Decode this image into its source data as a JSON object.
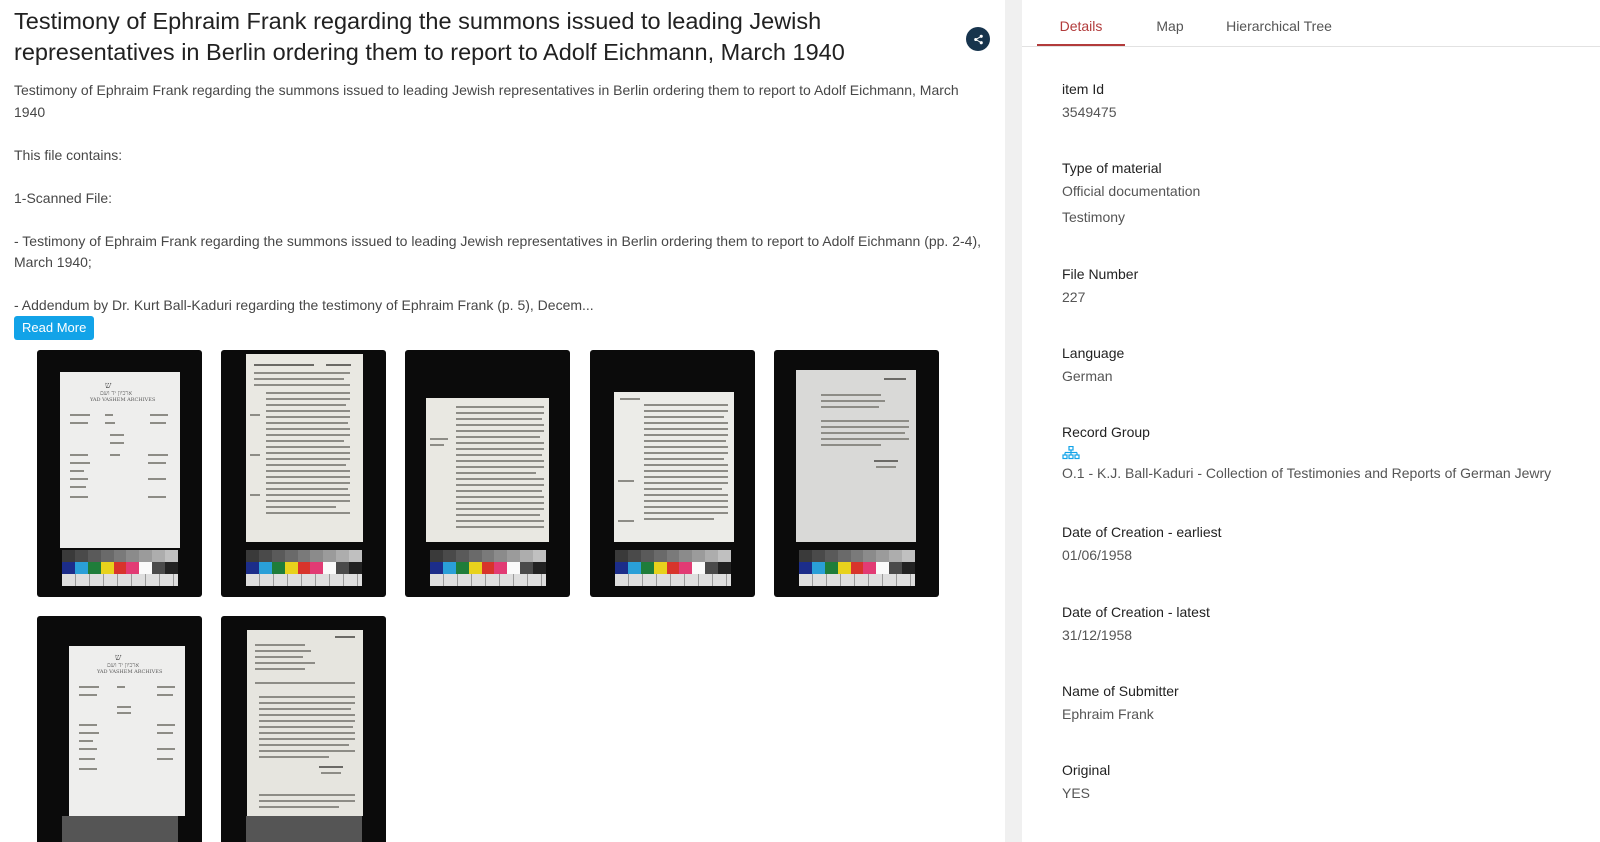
{
  "header": {
    "title": "Testimony of Ephraim Frank regarding the summons issued to leading Jewish representatives in Berlin ordering them to report to Adolf Eichmann, March 1940",
    "share_icon": "share-icon"
  },
  "description": {
    "lines": [
      "Testimony of Ephraim Frank regarding the summons issued to leading Jewish representatives in Berlin ordering them to report to Adolf Eichmann, March 1940",
      "This file contains:",
      "1-Scanned File:",
      "- Testimony of Ephraim Frank regarding the summons issued to leading Jewish representatives in Berlin ordering them to report to Adolf Eichmann (pp. 2-4), March 1940;",
      "- Addendum by Dr. Kurt Ball-Kaduri regarding the testimony of Ephraim Frank (p. 5), Decem..."
    ],
    "read_more_label": "Read More"
  },
  "thumbnail_header": {
    "hebrew": "ארכיון יד ושם",
    "english": "YAD VASHEM ARCHIVES"
  },
  "tabs": [
    {
      "label": "Details",
      "active": true
    },
    {
      "label": "Map",
      "active": false
    },
    {
      "label": "Hierarchical Tree",
      "active": false
    }
  ],
  "details": [
    {
      "label": "item Id",
      "values": [
        "3549475"
      ]
    },
    {
      "label": "Type of material",
      "values": [
        "Official documentation",
        "Testimony"
      ]
    },
    {
      "label": "File Number",
      "values": [
        "227"
      ]
    },
    {
      "label": "Language",
      "values": [
        "German"
      ]
    },
    {
      "label": "Record Group",
      "values": [
        "O.1 - K.J. Ball-Kaduri - Collection of Testimonies and Reports of German Jewry"
      ],
      "icon": "hierarchy-icon"
    },
    {
      "label": "Date of Creation - earliest",
      "values": [
        "01/06/1958"
      ]
    },
    {
      "label": "Date of Creation - latest",
      "values": [
        "31/12/1958"
      ]
    },
    {
      "label": "Name of Submitter",
      "values": [
        "Ephraim Frank"
      ]
    },
    {
      "label": "Original",
      "values": [
        "YES"
      ]
    }
  ],
  "colors": {
    "accent_tab": "#b23b3b",
    "read_more_bg": "#12a3e8",
    "share_bg": "#17344d",
    "divider": "#f0f0f0"
  }
}
